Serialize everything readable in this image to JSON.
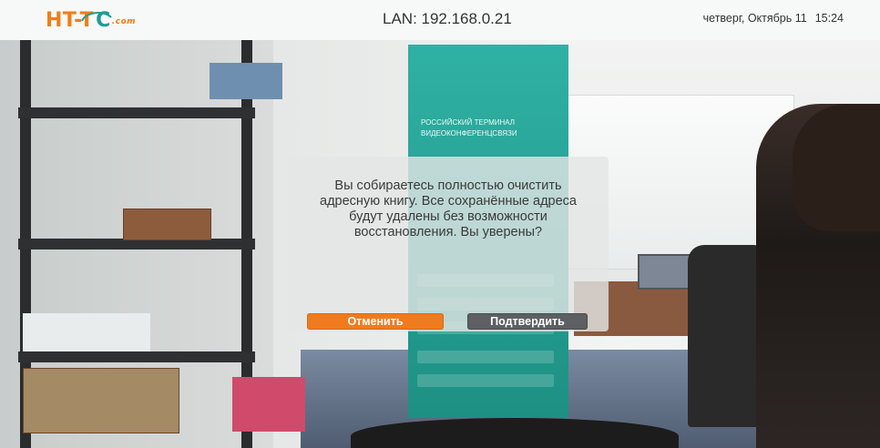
{
  "header": {
    "logo": {
      "left": "HT-T",
      "right": "C",
      "suffix": ".com"
    },
    "lan": "LAN: 192.168.0.21",
    "day_date": "четверг, Октябрь 11",
    "time": "15:24"
  },
  "banner": {
    "title": "РОССИЙСКИЙ ТЕРМИНАЛ ВИДЕОКОНФЕРЕНЦСВЯЗИ"
  },
  "dialog": {
    "message": "Вы собираетесь полностью очистить адресную книгу. Все сохранённые адреса будут удалены без возможности восстановления. Вы уверены?",
    "cancel_label": "Отменить",
    "confirm_label": "Подтвердить"
  },
  "colors": {
    "accent_orange": "#f07b1e",
    "brand_teal": "#1f9c96",
    "button_gray": "#5d5f62"
  }
}
